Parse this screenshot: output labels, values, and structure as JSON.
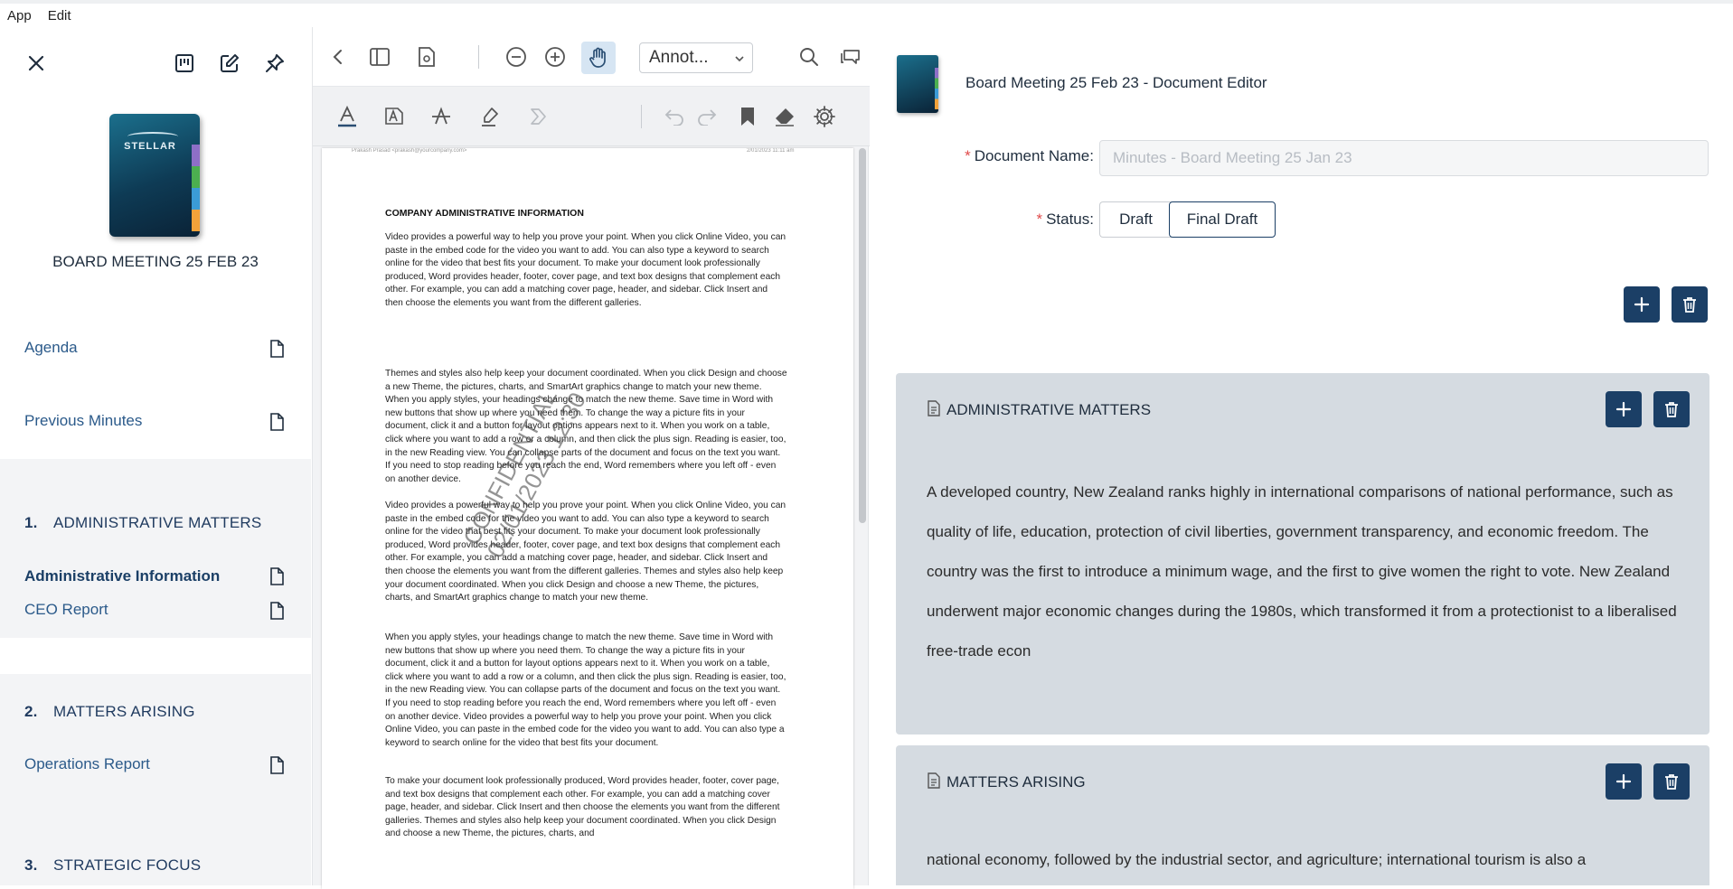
{
  "menu": {
    "items": [
      "App",
      "Edit"
    ]
  },
  "sidebar": {
    "title": "BOARD MEETING 25 FEB 23",
    "book_logo": "STELLAR",
    "items": [
      {
        "label": "Agenda"
      },
      {
        "label": "Previous Minutes"
      }
    ],
    "sections": [
      {
        "number": "1.",
        "title": "ADMINISTRATIVE MATTERS",
        "items": [
          {
            "label": "Administrative Information",
            "active": true
          },
          {
            "label": "CEO Report"
          }
        ]
      },
      {
        "number": "2.",
        "title": "MATTERS ARISING",
        "items": [
          {
            "label": "Operations Report"
          }
        ]
      },
      {
        "number": "3.",
        "title": "STRATEGIC FOCUS",
        "items": []
      }
    ]
  },
  "viewer": {
    "annotation_mode": "Annot...",
    "page": {
      "header_left": "Prakash Prasad <prakash@yourcompany.com>",
      "header_right": "2/01/2023 11:11 am",
      "heading": "COMPANY ADMINISTRATIVE INFORMATION",
      "paragraphs": [
        "Video provides a powerful way to help you prove your point. When you click Online Video, you can paste in the embed code for the video you want to add. You can also type a keyword to search online for the video that best fits your document. To make your document look professionally produced, Word provides header, footer, cover page, and text box designs that complement each other. For example, you can add a matching cover page, header, and sidebar. Click Insert and then choose the elements you want from the different galleries.",
        "Themes and styles also help keep your document coordinated. When you click Design and choose a new Theme, the pictures, charts, and SmartArt graphics change to match your new theme. When you apply styles, your headings change to match the new theme. Save time in Word with new buttons that show up where you need them. To change the way a picture fits in your document, click it and a button for layout options appears next to it. When you work on a table, click where you want to add a row or a column, and then click the plus sign. Reading is easier, too, in the new Reading view. You can collapse parts of the document and focus on the text you want. If you need to stop reading before you reach the end, Word remembers where you left off - even on another device.",
        "Video provides a powerful way to help you prove your point. When you click Online Video, you can paste in the embed code for the video you want to add. You can also type a keyword to search online for the video that best fits your document. To make your document look professionally produced, Word provides header, footer, cover page, and text box designs that complement each other. For example, you can add a matching cover page, header, and sidebar. Click Insert and then choose the elements you want from the different galleries. Themes and styles also help keep your document coordinated. When you click Design and choose a new Theme, the pictures, charts, and SmartArt graphics change to match your new theme.",
        "When you apply styles, your headings change to match the new theme. Save time in Word with new buttons that show up where you need them. To change the way a picture fits in your document, click it and a button for layout options appears next to it. When you work on a table, click where you want to add a row or a column, and then click the plus sign. Reading is easier, too, in the new Reading view. You can collapse parts of the document and focus on the text you want. If you need to stop reading before you reach the end, Word remembers where you left off - even on another device. Video provides a powerful way to help you prove your point. When you click Online Video, you can paste in the embed code for the video you want to add. You can also type a keyword to search online for the video that best fits your document.",
        "To make your document look professionally produced, Word provides header, footer, cover page, and text box designs that complement each other. For example, you can add a matching cover page, header, and sidebar. Click Insert and then choose the elements you want from the different galleries. Themes and styles also help keep your document coordinated. When you click Design and choose a new Theme, the pictures, charts, and"
      ],
      "watermark_line1": "CONFIDENTIAL",
      "watermark_line2": "02/01/2023 12:30"
    }
  },
  "editor": {
    "title": "Board Meeting 25 Feb 23 - Document Editor",
    "doc_name_label": "Document Name",
    "doc_name_placeholder": "Minutes - Board Meeting 25 Jan 23",
    "status_label": "Status",
    "status_options": [
      "Draft",
      "Final Draft"
    ],
    "status_selected": "Final Draft",
    "cards": [
      {
        "title": "ADMINISTRATIVE MATTERS",
        "body": "A developed country, New Zealand ranks highly in international comparisons of national performance, such as quality of life, education, protection of civil liberties, government transparency, and economic freedom. The country was the first to introduce a minimum wage, and the first to give women the right to vote. New Zealand underwent major economic changes during the 1980s, which transformed it from a protectionist to a liberalised free-trade econ"
      },
      {
        "title": "MATTERS ARISING",
        "body": "national economy, followed by the industrial sector, and agriculture; international tourism is also a"
      }
    ]
  },
  "colors": {
    "primary": "#1b3f66",
    "card_bg": "#d5dbe1",
    "required": "#e04b4b",
    "link": "#2b5a8a"
  }
}
